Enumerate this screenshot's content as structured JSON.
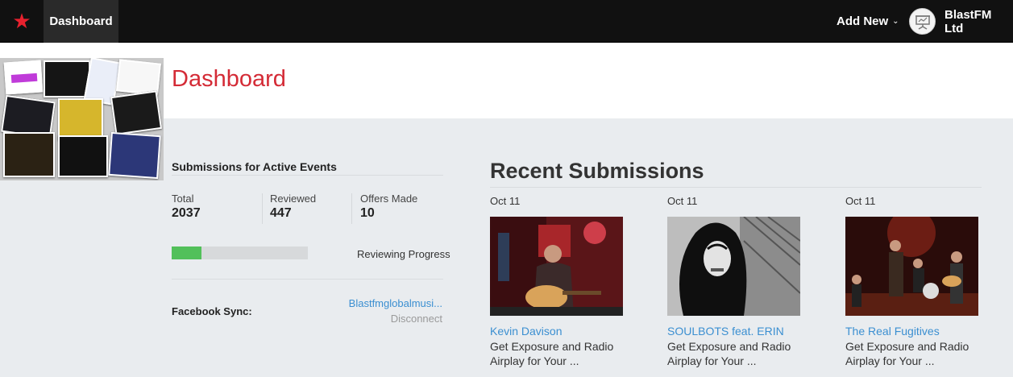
{
  "nav": {
    "active_item": "Dashboard",
    "add_new": "Add New",
    "account_name": "BlastFM Ltd"
  },
  "page": {
    "title": "Dashboard"
  },
  "submissions": {
    "heading": "Submissions for Active Events",
    "stats": [
      {
        "label": "Total",
        "value": "2037"
      },
      {
        "label": "Reviewed",
        "value": "447"
      },
      {
        "label": "Offers Made",
        "value": "10"
      }
    ],
    "progress_label": "Reviewing Progress",
    "progress_fraction": 0.22
  },
  "facebook": {
    "label": "Facebook Sync:",
    "account": "Blastfmglobalmusi...",
    "disconnect": "Disconnect"
  },
  "recent": {
    "heading": "Recent Submissions",
    "items": [
      {
        "date": "Oct 11",
        "name": "Kevin Davison",
        "description": "Get Exposure and Radio Airplay for Your ..."
      },
      {
        "date": "Oct 11",
        "name": "SOULBOTS feat. ERIN",
        "description": "Get Exposure and Radio Airplay for Your ..."
      },
      {
        "date": "Oct 11",
        "name": "The Real Fugitives",
        "description": "Get Exposure and Radio Airplay for Your ..."
      }
    ]
  },
  "colors": {
    "brand_red": "#d42b36",
    "link_blue": "#3b8fd1",
    "progress_green": "#52c05a"
  }
}
